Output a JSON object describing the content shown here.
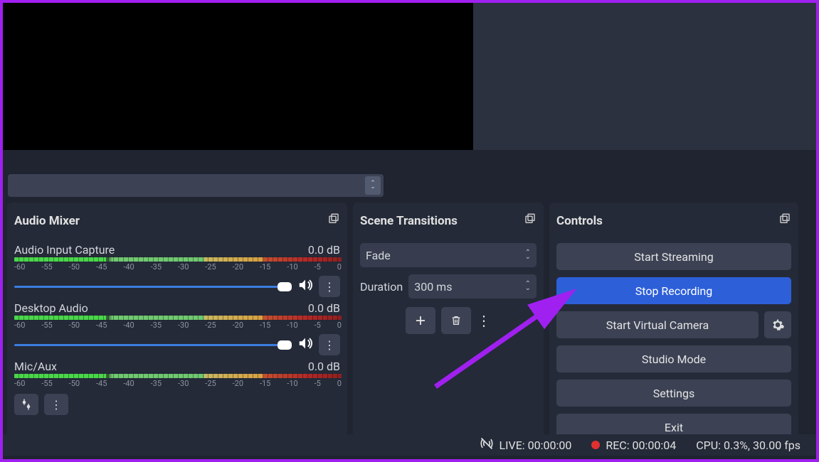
{
  "audioMixer": {
    "title": "Audio Mixer",
    "channels": [
      {
        "name": "Audio Input Capture",
        "level": "0.0 dB"
      },
      {
        "name": "Desktop Audio",
        "level": "0.0 dB"
      },
      {
        "name": "Mic/Aux",
        "level": "0.0 dB"
      }
    ],
    "scale": [
      "-60",
      "-55",
      "-50",
      "-45",
      "-40",
      "-35",
      "-30",
      "-25",
      "-20",
      "-15",
      "-10",
      "-5",
      "0"
    ]
  },
  "sceneTransitions": {
    "title": "Scene Transitions",
    "selected": "Fade",
    "durationLabel": "Duration",
    "durationValue": "300 ms"
  },
  "controls": {
    "title": "Controls",
    "buttons": {
      "startStreaming": "Start Streaming",
      "stopRecording": "Stop Recording",
      "startVirtualCam": "Start Virtual Camera",
      "studioMode": "Studio Mode",
      "settings": "Settings",
      "exit": "Exit"
    }
  },
  "statusBar": {
    "live": "LIVE: 00:00:00",
    "rec": "REC: 00:00:04",
    "cpu": "CPU: 0.3%, 30.00 fps"
  }
}
